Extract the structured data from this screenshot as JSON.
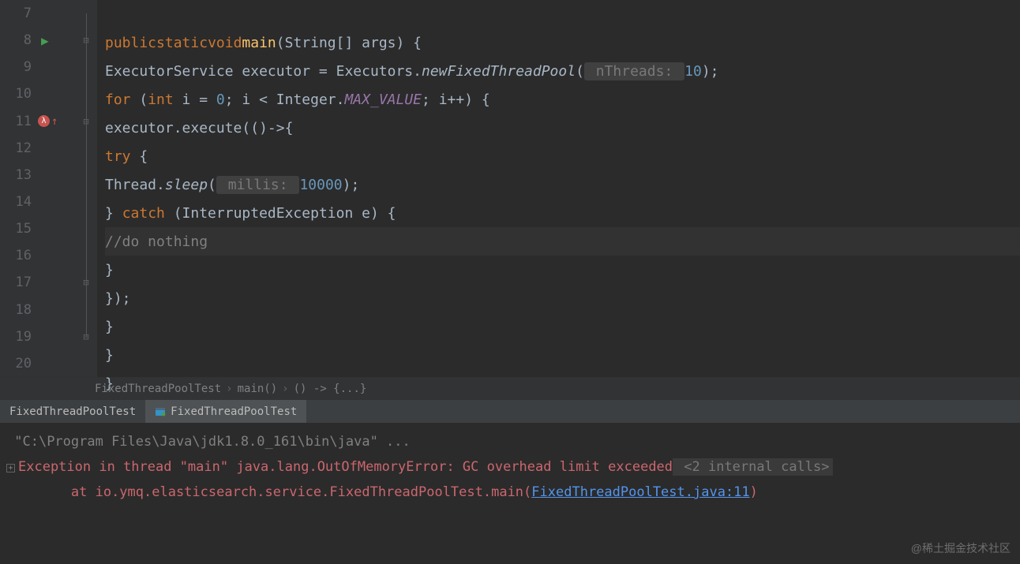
{
  "gutter": {
    "lines": [
      "7",
      "8",
      "9",
      "10",
      "11",
      "12",
      "13",
      "14",
      "15",
      "16",
      "17",
      "18",
      "19",
      "20"
    ]
  },
  "code": {
    "l8": {
      "public": "public",
      "static": "static",
      "void": "void",
      "main": "main",
      "params": "(String[] args) {"
    },
    "l9": {
      "type": "ExecutorService",
      "var": " executor = Executors.",
      "method": "newFixedThreadPool",
      "open": "(",
      "hint": " nThreads: ",
      "val": "10",
      "close": ");"
    },
    "l10": {
      "for": "for",
      "open": " (",
      "int": "int",
      "init": " i = ",
      "zero": "0",
      "cond": "; i < Integer.",
      "max": "MAX_VALUE",
      "rest": "; i++) {"
    },
    "l11": {
      "call": "executor.execute(()->{"
    },
    "l12": {
      "try": "try",
      "brace": " {"
    },
    "l13": {
      "thread": "Thread.",
      "sleep": "sleep",
      "open": "(",
      "hint": " millis: ",
      "val": "10000",
      "close": ");"
    },
    "l14": {
      "close": "} ",
      "catch": "catch",
      "rest": " (InterruptedException e) {"
    },
    "l15": {
      "comment": "//do nothing"
    },
    "l16": {
      "brace": "}"
    },
    "l17": {
      "close": "});"
    },
    "l18": {
      "brace": "}"
    },
    "l19": {
      "brace": "}"
    },
    "l20": {
      "brace": "}"
    }
  },
  "breadcrumb": {
    "c1": "FixedThreadPoolTest",
    "c2": "main()",
    "c3": "() -> {...}"
  },
  "runTabs": {
    "t1": "FixedThreadPoolTest",
    "t2": "FixedThreadPoolTest"
  },
  "console": {
    "cmd": "\"C:\\Program Files\\Java\\jdk1.8.0_161\\bin\\java\" ...",
    "err1": "Exception in thread \"main\" java.lang.OutOfMemoryError: GC overhead limit exceeded",
    "hint": " <2 internal calls>",
    "err2_pre": "\tat io.ymq.elasticsearch.service.FixedThreadPoolTest.main",
    "err2_link": "FixedThreadPoolTest.java:11"
  },
  "watermark": "@稀土掘金技术社区"
}
